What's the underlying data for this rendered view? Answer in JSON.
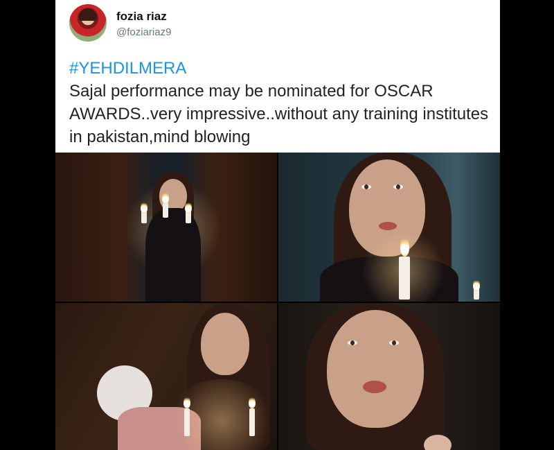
{
  "tweet": {
    "display_name": "fozia riaz",
    "handle": "@foziariaz9",
    "hashtag": "#YEHDILMERA",
    "body": "Sajal performance may be nominated for OSCAR AWARDS..very impressive..without any training institutes in pakistan,mind blowing"
  },
  "colors": {
    "hashtag": "#1b95e0",
    "handle": "#657786",
    "background": "#000000",
    "card": "#ffffff"
  },
  "images": [
    {
      "panel": 1,
      "subject": "woman holding candelabra in dark hallway"
    },
    {
      "panel": 2,
      "subject": "close-up of frightened woman behind lit candle"
    },
    {
      "panel": 3,
      "subject": "woman with doll and candles"
    },
    {
      "panel": 4,
      "subject": "close-up of woman with open mouth"
    }
  ]
}
